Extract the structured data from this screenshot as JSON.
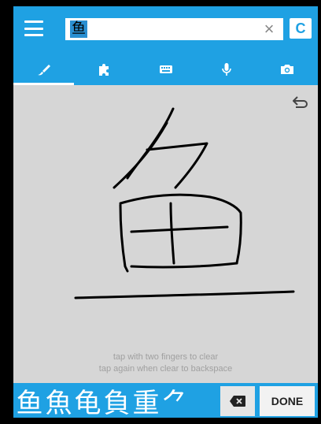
{
  "top_bar": {
    "menu_icon": "hamburger-menu-icon",
    "search_value": "鱼",
    "clear_icon": "×",
    "c_button_label": "C",
    "accent_color": "#1fa1e3"
  },
  "tabs": [
    {
      "icon": "brush-icon",
      "active": true
    },
    {
      "icon": "puzzle-icon",
      "active": false
    },
    {
      "icon": "keyboard-icon",
      "active": false
    },
    {
      "icon": "microphone-icon",
      "active": false
    },
    {
      "icon": "camera-icon",
      "active": false
    }
  ],
  "canvas": {
    "undo_icon": "undo-icon",
    "hint_line1": "tap with two fingers to clear",
    "hint_line2": "tap again when clear to backspace"
  },
  "bottom_bar": {
    "candidates": [
      "鱼",
      "魚",
      "龟",
      "負",
      "重",
      "⺈"
    ],
    "backspace_icon": "backspace-icon",
    "done_label": "DONE"
  }
}
